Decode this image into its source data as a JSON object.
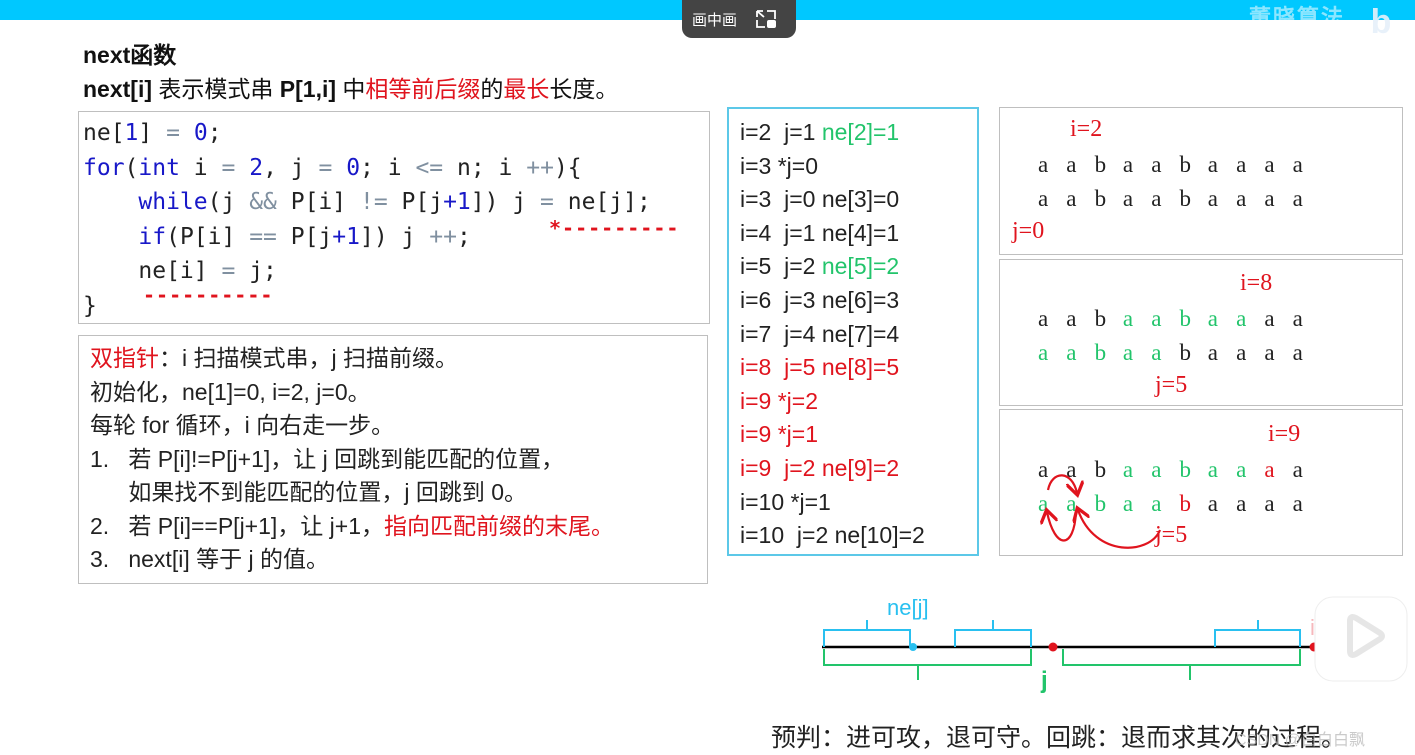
{
  "top_bar": {
    "color": "#00c8ff",
    "brand_text": "董晓算法",
    "brand_logo": "bili-logo"
  },
  "pip_button": {
    "label": "画中画",
    "icon": "pip-exit-icon"
  },
  "header": {
    "title": "next函数",
    "subtitle_prefix_bold": "next[i]",
    "subtitle_part1": " 表示模式串 ",
    "subtitle_bold2": "P[1,i]",
    "subtitle_part2": " 中",
    "subtitle_red1": "相等前后缀",
    "subtitle_part3": "的",
    "subtitle_red2": "最长",
    "subtitle_part4": "长度。"
  },
  "code": {
    "lines": [
      "ne[1] = 0;",
      "for(int i = 2, j = 0; i <= n; i ++){",
      "    while(j && P[i] != P[j+1]) j = ne[j];",
      "    if(P[i] == P[j+1]) j ++;",
      "    ne[i] = j;",
      "}"
    ],
    "annotation_star": "*---------",
    "annotation_dash": "----------"
  },
  "notes": {
    "line1_red": "双指针",
    "line1_rest": "：i 扫描模式串，j 扫描前缀。",
    "line2": "初始化，ne[1]=0, i=2, j=0。",
    "line3": "每轮 for 循环，i 向右走一步。",
    "line4": "1.   若 P[i]!=P[j+1]，让 j 回跳到能匹配的位置，",
    "line5": "      如果找不到能匹配的位置，j 回跳到 0。",
    "line6_prefix": "2.   若 P[i]==P[j+1]，让 j+1，",
    "line6_red": "指向匹配前缀的末尾。",
    "line7": "3.   next[i] 等于 j 的值。"
  },
  "trace": {
    "rows": [
      {
        "head": "i=2  j=1 ",
        "tail": "ne[2]=1",
        "head_color": "dark",
        "tail_color": "green"
      },
      {
        "head": "i=3 *j=0",
        "tail": "",
        "head_color": "dark",
        "tail_color": "dark"
      },
      {
        "head": "i=3  j=0 ",
        "tail": "ne[3]=0",
        "head_color": "dark",
        "tail_color": "dark"
      },
      {
        "head": "i=4  j=1 ",
        "tail": "ne[4]=1",
        "head_color": "dark",
        "tail_color": "dark"
      },
      {
        "head": "i=5  j=2 ",
        "tail": "ne[5]=2",
        "head_color": "dark",
        "tail_color": "green"
      },
      {
        "head": "i=6  j=3 ",
        "tail": "ne[6]=3",
        "head_color": "dark",
        "tail_color": "dark"
      },
      {
        "head": "i=7  j=4 ",
        "tail": "ne[7]=4",
        "head_color": "dark",
        "tail_color": "dark"
      },
      {
        "head": "i=8  j=5 ",
        "tail": "ne[8]=5",
        "head_color": "red",
        "tail_color": "red"
      },
      {
        "head": "i=9 *j=2",
        "tail": "",
        "head_color": "red",
        "tail_color": "red"
      },
      {
        "head": "i=9 *j=1",
        "tail": "",
        "head_color": "red",
        "tail_color": "red"
      },
      {
        "head": "i=9  j=2 ",
        "tail": "ne[9]=2",
        "head_color": "red",
        "tail_color": "red"
      },
      {
        "head": "i=10 *j=1",
        "tail": "",
        "head_color": "dark",
        "tail_color": "dark"
      },
      {
        "head": "i=10  j=2 ",
        "tail": "ne[10]=2",
        "head_color": "dark",
        "tail_color": "dark"
      }
    ]
  },
  "panels": [
    {
      "i_label": "i=2",
      "j_label": "j=0",
      "top": [
        "a",
        "a",
        "b",
        "a",
        "a",
        "b",
        "a",
        "a",
        "a",
        "a"
      ],
      "top_colors": [
        "d",
        "d",
        "d",
        "d",
        "d",
        "d",
        "d",
        "d",
        "d",
        "d"
      ],
      "bottom": [
        "a",
        "a",
        "b",
        "a",
        "a",
        "b",
        "a",
        "a",
        "a",
        "a"
      ],
      "bottom_colors": [
        "d",
        "d",
        "d",
        "d",
        "d",
        "d",
        "d",
        "d",
        "d",
        "d"
      ]
    },
    {
      "i_label": "i=8",
      "j_label": "j=5",
      "top": [
        "a",
        "a",
        "b",
        "a",
        "a",
        "b",
        "a",
        "a",
        "a",
        "a"
      ],
      "top_colors": [
        "d",
        "d",
        "d",
        "g",
        "g",
        "g",
        "g",
        "g",
        "d",
        "d"
      ],
      "bottom": [
        "a",
        "a",
        "b",
        "a",
        "a",
        "b",
        "a",
        "a",
        "a",
        "a"
      ],
      "bottom_colors": [
        "g",
        "g",
        "g",
        "g",
        "g",
        "d",
        "d",
        "d",
        "d",
        "d"
      ]
    },
    {
      "i_label": "i=9",
      "j_label": "j=5",
      "top": [
        "a",
        "a",
        "b",
        "a",
        "a",
        "b",
        "a",
        "a",
        "a",
        "a"
      ],
      "top_colors": [
        "d",
        "d",
        "d",
        "g",
        "g",
        "g",
        "g",
        "g",
        "r",
        "d"
      ],
      "bottom": [
        "a",
        "a",
        "b",
        "a",
        "a",
        "b",
        "a",
        "a",
        "a",
        "a"
      ],
      "bottom_colors": [
        "g",
        "g",
        "g",
        "g",
        "g",
        "r",
        "d",
        "d",
        "d",
        "d"
      ]
    }
  ],
  "diagram": {
    "ne_label": "ne[j]",
    "j_label": "j",
    "i_label": "i"
  },
  "bottom_caption": "预判：进可攻，退可守。回跳：退而求其次的过程。",
  "watermark": "CSDN @白白白飘",
  "colors": {
    "red": "#e0141e",
    "green": "#22c46b",
    "cyan": "#29c0f0",
    "code_keyword": "#1818c8"
  }
}
